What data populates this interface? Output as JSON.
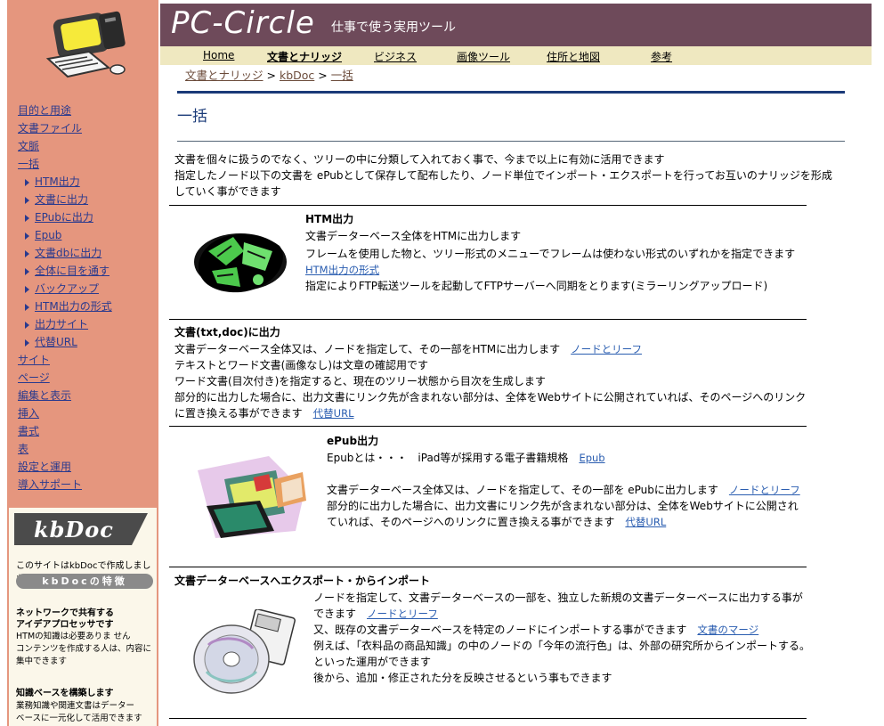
{
  "header": {
    "brand": "PC-Circle",
    "tagline": "仕事で使う実用ツール"
  },
  "menu": [
    {
      "label": "Home"
    },
    {
      "label": "文書とナリッジ"
    },
    {
      "label": "ビジネス"
    },
    {
      "label": "画像ツール"
    },
    {
      "label": "住所と地図"
    },
    {
      "label": "参考"
    }
  ],
  "breadcrumb": {
    "items": [
      "文書とナリッジ",
      "kbDoc",
      "一括"
    ],
    "sep": ">"
  },
  "page_title": "一括",
  "intro": [
    "文書を個々に扱うのでなく、ツリーの中に分類して入れておく事で、今まで以上に有効に活用できます",
    "指定したノード以下の文書を ePubとして保存して配布したり、ノード単位でインポート・エクスポートを行ってお互いのナリッジを形成",
    "していく事ができます"
  ],
  "sidebar": {
    "items": [
      {
        "label": "目的と用途"
      },
      {
        "label": "文書ファイル"
      },
      {
        "label": "文脈"
      },
      {
        "label": "一括"
      },
      {
        "label": "HTM出力"
      },
      {
        "label": "文書に出力"
      },
      {
        "label": "EPubに出力"
      },
      {
        "label": "Epub"
      },
      {
        "label": "文書dbに出力"
      },
      {
        "label": "全体に目を通す"
      },
      {
        "label": "バックアップ"
      },
      {
        "label": "HTM出力の形式"
      },
      {
        "label": "出力サイト"
      },
      {
        "label": "代替URL"
      },
      {
        "label": "サイト"
      },
      {
        "label": "ページ"
      },
      {
        "label": "編集と表示"
      },
      {
        "label": "挿入"
      },
      {
        "label": "書式"
      },
      {
        "label": "表"
      },
      {
        "label": "設定と運用"
      },
      {
        "label": "導入サポート"
      }
    ],
    "kb_logo": "kbDoc",
    "kb_made": "このサイトはkbDocで作成しました",
    "kb_feature": "kbDocの特徴",
    "kb_h1a": "ネットワークで共有する",
    "kb_h1b": "アイデアプロセッサです",
    "kb_t1": "HTMの知識は必要ありま せん",
    "kb_t2": "コンテンツを作成する人は、内容に",
    "kb_t3": "集中できます",
    "kb_h2": "知識ベースを構築します",
    "kb_t4": "業務知識や関連文書はデーター",
    "kb_t5": "ベースに一元化して活用できます"
  },
  "sections": {
    "htm": {
      "title": "HTM出力",
      "l1": "文書データーベース全体をHTMに出力します",
      "l2": "フレームを使用した物と、ツリー形式のメニューでフレームは使わない形式のいずれかを指定できます",
      "link1": "HTM出力の形式",
      "l3": "指定によりFTP転送ツールを起動してFTPサーバーへ同期をとります(ミラーリングアップロード)"
    },
    "doc": {
      "title": "文書(txt,doc)に出力",
      "l1": "文書データーベース全体又は、ノードを指定して、その一部をHTMに出力します",
      "link1": "ノードとリーフ",
      "l2": "テキストとワード文書(画像なし)は文章の確認用です",
      "l3": "ワード文書(目次付き)を指定すると、現在のツリー状態から目次を生成します",
      "l4": "部分的に出力した場合に、出力文書にリンク先が含まれない部分は、全体をWebサイトに公開されていれば、そのページへのリンク",
      "l5": "に置き換える事ができます",
      "link2": "代替URL"
    },
    "epub": {
      "title": "ePub出力",
      "l1": "Epubとは・・・　iPad等が採用する電子書籍規格",
      "link1": "Epub",
      "l2": "文書データーベース全体又は、ノードを指定して、その一部を ePubに出力します",
      "link2": "ノードとリーフ",
      "l3": "部分的に出力した場合に、出力文書にリンク先が含まれない部分は、全体をWebサイトに公開され",
      "l4": "ていれば、そのページへのリンクに置き換える事ができます",
      "link3": "代替URL"
    },
    "db": {
      "title": "文書データーベースへエクスポート・からインポート",
      "l1": "ノードを指定して、文書データーベースの一部を、独立した新規の文書データーベースに出力する事が",
      "l2": "できます",
      "link1": "ノードとリーフ",
      "l3": "又、既存の文書データーベースを特定のノードにインポートする事ができます",
      "link2": "文書のマージ",
      "l4": "例えば、「衣料品の商品知識」の中のノードの「今年の流行色」は、外部の研究所からインポートする。",
      "l5": "といった運用ができます",
      "l6": "後から、追加・修正された分を反映させるという事もできます"
    }
  },
  "colors": {
    "sidebar_bg": "#e5967e",
    "header_bg": "#6e4a5a",
    "menubar_bg": "#efe8c0",
    "title_color": "#1a3a78"
  }
}
